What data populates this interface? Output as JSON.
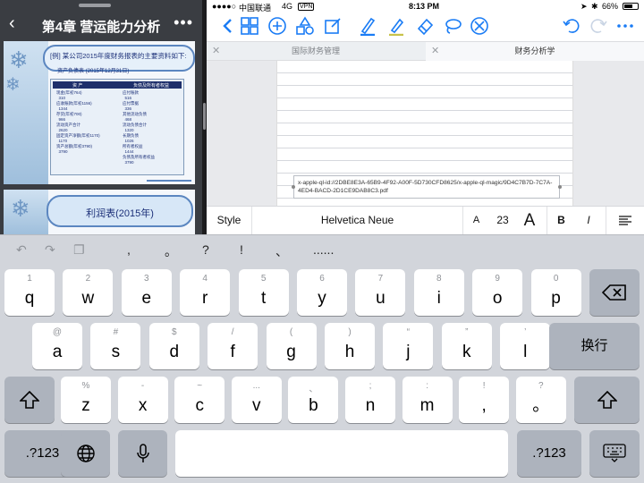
{
  "left_pane": {
    "title": "第4章  营运能力分析",
    "back_glyph": "‹",
    "more_glyph": "•••",
    "slide1": {
      "heading": "[例] 某公司2015年度财务报表的主要资料如下:",
      "subheading": "资产负债表 (2015年12月31日)",
      "table": {
        "headers": [
          "资    产",
          "负债及所有者权益"
        ],
        "left_col": "现金(年初764)\n  310\n应收账款(年初1156)\n  1344\n存货(年初700)\n  966\n流动资产合计\n  2620\n固定资产净额(年初1170)\n  1170\n资产总额(年初3790)\n  3790",
        "right_col": "应付账款\n  516\n应付票据\n  336\n其他流动负债\n  468\n流动负债合计\n  1320\n长期负债\n  1026\n所有者权益\n  1444\n负债及所有者权益\n  3790"
      }
    },
    "slide2": {
      "heading": "利润表(2015年)"
    }
  },
  "status_bar": {
    "carrier": "中国联通",
    "network": "4G",
    "vpn": "VPN",
    "time": "8:13 PM",
    "battery_text": "66%",
    "battery_level": 0.66
  },
  "toolbar": {
    "icons": [
      "back-icon",
      "grid-icon",
      "add-icon",
      "shapes-icon",
      "compose-icon",
      "pen-icon",
      "highlighter-icon",
      "eraser-icon",
      "lasso-icon",
      "clear-icon",
      "undo-icon",
      "redo-icon",
      "more-icon"
    ],
    "accent": "#1a7cf5"
  },
  "tabs": [
    {
      "label": "国际财务管理",
      "active": false
    },
    {
      "label": "财务分析学",
      "active": true
    }
  ],
  "document": {
    "textbox_text": "x-apple-ql-id://2DBE8E3A-65B9-4F92-A00F-5D730CFD8625/x-apple-ql-magic/9D4C7B7D-7C7A-4ED4-BACD-2D1CE9DAB8C3.pdf"
  },
  "format_bar": {
    "style_label": "Style",
    "font_name": "Helvetica Neue",
    "small_a": "A",
    "font_size": "23",
    "large_a": "A",
    "bold": "B",
    "italic": "I"
  },
  "predictions": {
    "items": [
      ",",
      "。",
      "?",
      "!",
      "、",
      "......"
    ]
  },
  "keyboard": {
    "row1": [
      {
        "hint": "1",
        "key": "q"
      },
      {
        "hint": "2",
        "key": "w"
      },
      {
        "hint": "3",
        "key": "e"
      },
      {
        "hint": "4",
        "key": "r"
      },
      {
        "hint": "5",
        "key": "t"
      },
      {
        "hint": "6",
        "key": "y"
      },
      {
        "hint": "7",
        "key": "u"
      },
      {
        "hint": "8",
        "key": "i"
      },
      {
        "hint": "9",
        "key": "o"
      },
      {
        "hint": "0",
        "key": "p"
      }
    ],
    "row2": [
      {
        "hint": "@",
        "key": "a"
      },
      {
        "hint": "#",
        "key": "s"
      },
      {
        "hint": "$",
        "key": "d"
      },
      {
        "hint": "/",
        "key": "f"
      },
      {
        "hint": "(",
        "key": "g"
      },
      {
        "hint": ")",
        "key": "h"
      },
      {
        "hint": "“",
        "key": "j"
      },
      {
        "hint": "”",
        "key": "k"
      },
      {
        "hint": "’",
        "key": "l"
      }
    ],
    "row3": [
      {
        "hint": "%",
        "key": "z"
      },
      {
        "hint": "-",
        "key": "x"
      },
      {
        "hint": "~",
        "key": "c"
      },
      {
        "hint": "...",
        "key": "v"
      },
      {
        "hint": "、",
        "key": "b"
      },
      {
        "hint": ";",
        "key": "n"
      },
      {
        "hint": ":",
        "key": "m"
      },
      {
        "hint": "!",
        "key": ","
      },
      {
        "hint": "?",
        "key": "。"
      }
    ],
    "return_label": "换行",
    "numbers_label": ".?123",
    "space_label": ""
  }
}
